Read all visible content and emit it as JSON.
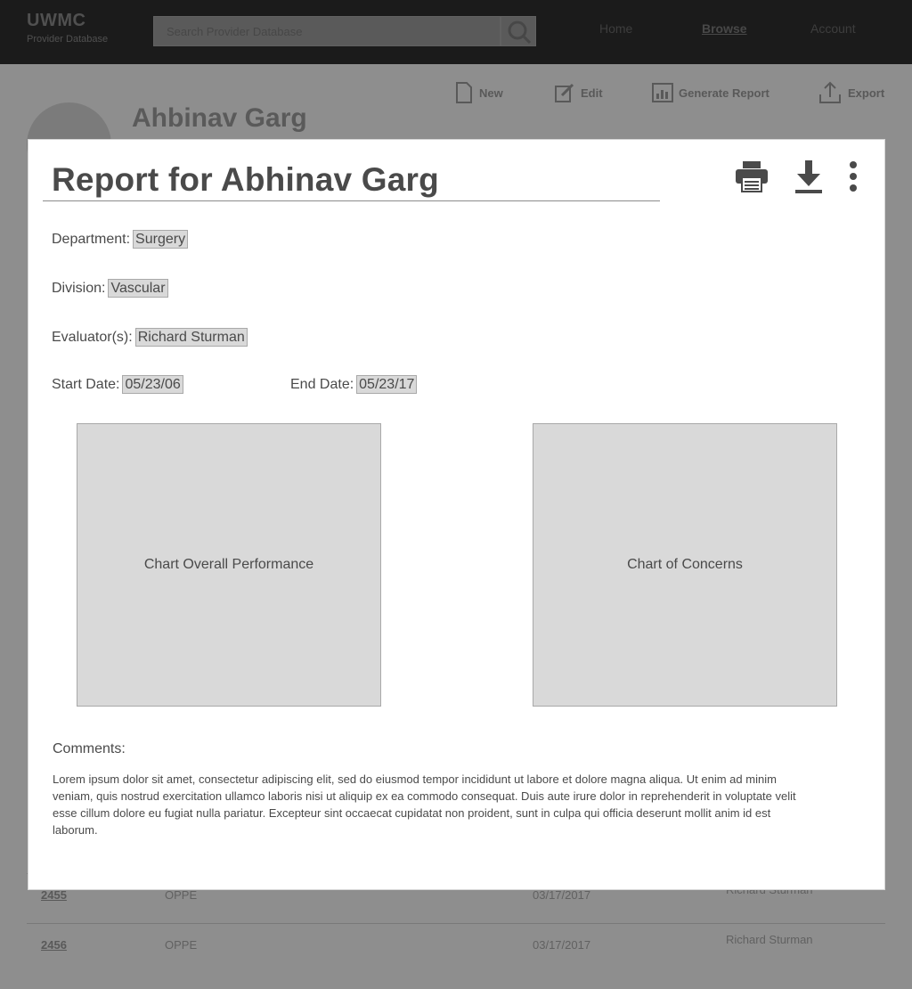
{
  "app": {
    "brand": "UWMC",
    "brand_sub": "Provider Database",
    "search_placeholder": "Search Provider Database",
    "nav": [
      "Home",
      "Browse",
      "Account"
    ]
  },
  "toolbar": {
    "new_label": "New",
    "edit_label": "Edit",
    "report_label": "Generate Report",
    "export_label": "Export"
  },
  "profile": {
    "name": "Ahbinav Garg"
  },
  "background_rows": [
    {
      "id": "2455",
      "type": "OPPE",
      "date": "03/17/2017",
      "evaluator": "Richard Sturman"
    },
    {
      "id": "2456",
      "type": "OPPE",
      "date": "03/17/2017",
      "evaluator": "Richard Sturman"
    }
  ],
  "modal": {
    "title": "Report for Abhinav Garg",
    "actions": {
      "print": "printer-icon",
      "download": "download-icon",
      "more": "more-vertical-icon"
    },
    "department_label": "Department:",
    "department_value": "Surgery",
    "division_label": "Division:",
    "division_value": "Vascular",
    "evaluators_label": "Evaluator(s):",
    "evaluators_value": "Richard Sturman",
    "start_label": "Start Date:",
    "start_value": "05/23/06",
    "end_label": "End Date:",
    "end_value": "05/23/17",
    "chart_left": "Chart Overall Performance",
    "chart_right": "Chart of Concerns",
    "comments_label": "Comments:",
    "comments_text": "Lorem ipsum dolor sit amet, consectetur adipiscing elit, sed do eiusmod tempor incididunt ut labore et dolore magna aliqua. Ut enim ad minim veniam, quis nostrud exercitation ullamco laboris nisi ut aliquip ex ea commodo consequat. Duis aute irure dolor in reprehenderit in voluptate velit esse cillum dolore eu fugiat nulla pariatur. Excepteur sint occaecat cupidatat non proident, sunt in culpa qui officia deserunt mollit anim id est laborum."
  },
  "colors": {
    "overlay": "#000000",
    "field_fill": "#d9d9d9",
    "text": "#4a4a4a"
  }
}
